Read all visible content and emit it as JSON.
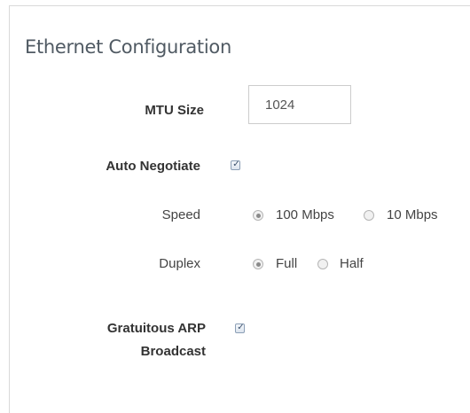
{
  "section": {
    "title": "Ethernet Configuration"
  },
  "mtu": {
    "label": "MTU Size",
    "value": "1024"
  },
  "auto_negotiate": {
    "label": "Auto Negotiate",
    "checked": true
  },
  "speed": {
    "label": "Speed",
    "options": [
      {
        "label": "100 Mbps",
        "selected": true
      },
      {
        "label": "10 Mbps",
        "selected": false
      }
    ]
  },
  "duplex": {
    "label": "Duplex",
    "options": [
      {
        "label": "Full",
        "selected": true
      },
      {
        "label": "Half",
        "selected": false
      }
    ]
  },
  "gratuitous_arp": {
    "label_line1": "Gratuitous ARP",
    "label_line2": "Broadcast",
    "checked": true
  },
  "icons": {
    "check": "✓"
  }
}
